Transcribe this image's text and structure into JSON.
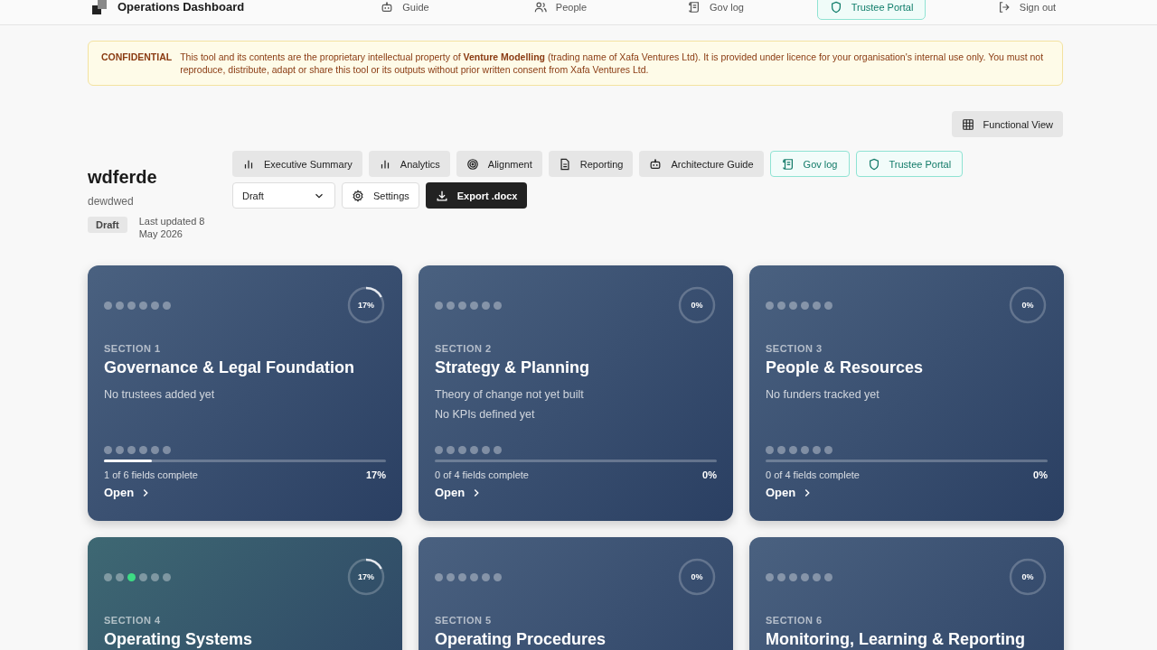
{
  "header": {
    "title": "Operations Dashboard",
    "nav": [
      {
        "label": "Guide",
        "selected": false
      },
      {
        "label": "People",
        "selected": false
      },
      {
        "label": "Gov log",
        "selected": false
      },
      {
        "label": "Trustee Portal",
        "selected": true
      },
      {
        "label": "Sign out",
        "selected": false
      }
    ]
  },
  "notice": {
    "label": "CONFIDENTIAL",
    "text": "This tool and its contents are the proprietary intellectual property of **Venture Modelling** (trading name of Xafa Ventures Ltd). It is provided under licence for your organisation's internal use only. You must not reproduce, distribute, adapt or share this tool or its outputs without prior written consent from Xafa Ventures Ltd."
  },
  "view_button": "Functional View",
  "project": {
    "name": "wdferde",
    "description": "dewdwed",
    "status": "Draft",
    "updated": "Last updated 8 May 2026"
  },
  "toolbar": [
    {
      "label": "Executive Summary",
      "kind": "grey"
    },
    {
      "label": "Analytics",
      "kind": "grey"
    },
    {
      "label": "Alignment",
      "kind": "grey"
    },
    {
      "label": "Reporting",
      "kind": "grey"
    },
    {
      "label": "Architecture Guide",
      "kind": "grey"
    },
    {
      "label": "Gov log",
      "kind": "teal"
    },
    {
      "label": "Trustee Portal",
      "kind": "teal"
    }
  ],
  "status_select": "Draft",
  "settings_button": "Settings",
  "export_button": "Export .docx",
  "sections": [
    {
      "section": "SECTION 1",
      "title": "Governance & Legal Foundation",
      "color": "#4a6180",
      "ring": "17%",
      "dots": [
        false,
        false,
        false,
        false,
        false,
        false
      ],
      "notes": [
        "No trustees added yet"
      ],
      "bottom_dots": [
        false,
        false,
        false,
        false,
        false,
        false
      ],
      "level": 0.17,
      "fields": "1 of 6 fields complete",
      "percent": "17%",
      "open": "Open"
    },
    {
      "section": "SECTION 2",
      "title": "Strategy & Planning",
      "color": "#4a6180",
      "ring": "0%",
      "dots": [
        false,
        false,
        false,
        false,
        false,
        false
      ],
      "notes": [
        "Theory of change not yet built",
        "No KPIs defined yet"
      ],
      "bottom_dots": [
        false,
        false,
        false,
        false,
        false,
        false
      ],
      "level": 0,
      "fields": "0 of 4 fields complete",
      "percent": "0%",
      "open": "Open"
    },
    {
      "section": "SECTION 3",
      "title": "People & Resources",
      "color": "#4a6180",
      "ring": "0%",
      "dots": [
        false,
        false,
        false,
        false,
        false,
        false
      ],
      "notes": [
        "No funders tracked yet"
      ],
      "bottom_dots": [
        false,
        false,
        false,
        false,
        false,
        false
      ],
      "level": 0,
      "fields": "0 of 4 fields complete",
      "percent": "0%",
      "open": "Open"
    },
    {
      "section": "SECTION 4",
      "title": "Operating Systems",
      "color": "#3e6873",
      "ring": "17%",
      "dots": [
        false,
        false,
        true,
        false,
        false,
        false
      ]
    },
    {
      "section": "SECTION 5",
      "title": "Operating Procedures",
      "color": "#4a6180",
      "ring": "0%",
      "dots": [
        false,
        false,
        false,
        false,
        false,
        false
      ]
    },
    {
      "section": "SECTION 6",
      "title": "Monitoring, Learning & Reporting",
      "color": "#4a6180",
      "ring": "0%",
      "dots": [
        false,
        false,
        false,
        false,
        false,
        false
      ]
    }
  ]
}
